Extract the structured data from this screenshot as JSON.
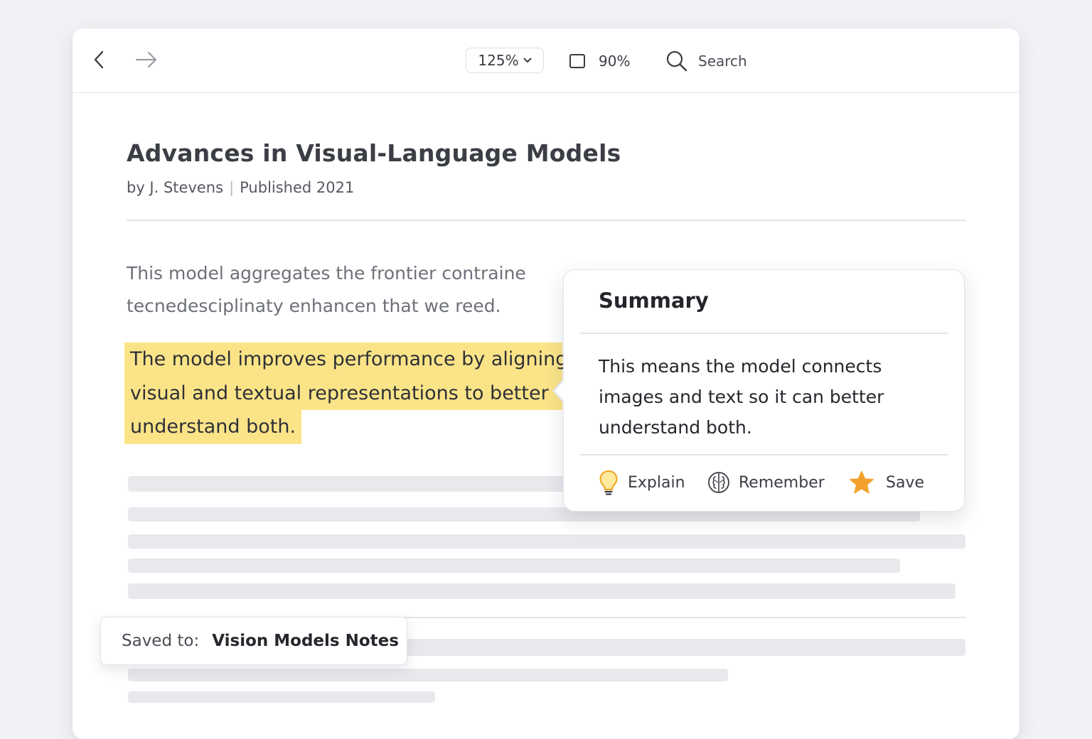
{
  "toolbar": {
    "back_icon": "arrow-left-icon",
    "forward_icon": "arrow-right-icon",
    "zoom_value": "125%",
    "fit_value": "90%",
    "search_label": "Search"
  },
  "document": {
    "title": "Advances in Visual-Language Models",
    "author": "by J. Stevens",
    "published": "Published 2021",
    "paragraph_lines": [
      "This model aggregates the frontier contraine",
      "tecnedesciplinaty enhancen that we reed."
    ],
    "highlight_lines": [
      "The model improves performance by aligning",
      "visual and textual representations to better",
      "understand both."
    ],
    "highlight_color": "#fbe488"
  },
  "summary_popover": {
    "title": "Summary",
    "body": "This means the model connects images and text so it can better understand both.",
    "actions": {
      "explain": "Explain",
      "remember": "Remember",
      "save": "Save"
    },
    "icons": {
      "explain": "lightbulb-icon",
      "remember": "brain-icon",
      "save": "star-icon"
    },
    "accent_color": "#f2a22c"
  },
  "toast": {
    "label": "Saved to:",
    "value": "Vision Models Notes"
  }
}
